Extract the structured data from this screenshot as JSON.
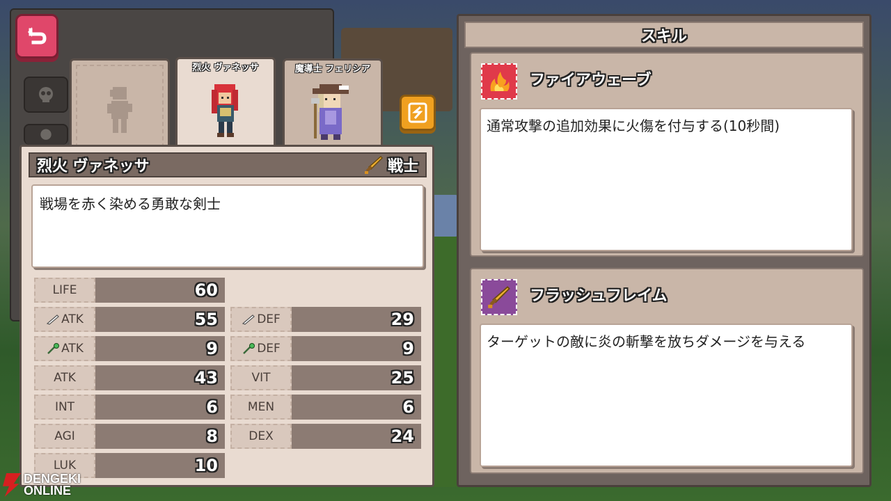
{
  "top": {
    "back_icon": "back-arrow-icon",
    "switch_icon": "swap-icon"
  },
  "tabs": [
    {
      "name": "",
      "state": "locked"
    },
    {
      "name": "烈火 ヴァネッサ",
      "state": "selected"
    },
    {
      "name": "魔導士 フェリシア",
      "state": "normal"
    }
  ],
  "character": {
    "name": "烈火 ヴァネッサ",
    "class": "戦士",
    "class_icon": "sword-icon",
    "description": "戦場を赤く染める勇敢な剣士"
  },
  "stats": {
    "life": {
      "label": "LIFE",
      "value": "60"
    },
    "patk": {
      "label": "ATK",
      "icon": "sword-icon",
      "value": "55"
    },
    "pdef": {
      "label": "DEF",
      "icon": "sword-icon",
      "value": "29"
    },
    "matk": {
      "label": "ATK",
      "icon": "staff-icon",
      "value": "9"
    },
    "mdef": {
      "label": "DEF",
      "icon": "staff-icon",
      "value": "9"
    },
    "atk": {
      "label": "ATK",
      "value": "43"
    },
    "vit": {
      "label": "VIT",
      "value": "25"
    },
    "int": {
      "label": "INT",
      "value": "6"
    },
    "men": {
      "label": "MEN",
      "value": "6"
    },
    "agi": {
      "label": "AGI",
      "value": "8"
    },
    "dex": {
      "label": "DEX",
      "value": "24"
    },
    "luk": {
      "label": "LUK",
      "value": "10"
    }
  },
  "skills": {
    "title": "スキル",
    "items": [
      {
        "name": "ファイアウェーブ",
        "icon": "fire-icon",
        "color": "#e03a4a",
        "description": "通常攻撃の追加効果に火傷を付与する(10秒間)"
      },
      {
        "name": "フラッシュフレイム",
        "icon": "sword-icon",
        "color": "#8a4a9a",
        "description": "ターゲットの敵に炎の斬撃を放ちダメージを与える"
      }
    ]
  },
  "watermark": {
    "line1": "DENGEKI",
    "line2": "ONLINE"
  }
}
